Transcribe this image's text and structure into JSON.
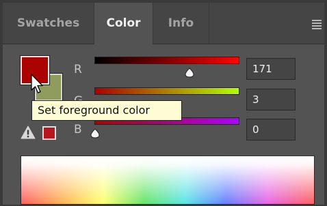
{
  "tabs": [
    "Swatches",
    "Color",
    "Info"
  ],
  "active_tab": "Color",
  "colors": {
    "foreground": "#ab0300",
    "background": "#8f9c5e",
    "gamut_warning": "#b8161c"
  },
  "tooltip": {
    "text": "Set foreground color"
  },
  "channels": [
    {
      "label": "R",
      "value": "171"
    },
    {
      "label": "G",
      "value": "3"
    },
    {
      "label": "B",
      "value": "0"
    }
  ],
  "icons": [
    "panel-menu-icon",
    "pointer-cursor-icon",
    "out-of-gamut-warning-icon"
  ]
}
